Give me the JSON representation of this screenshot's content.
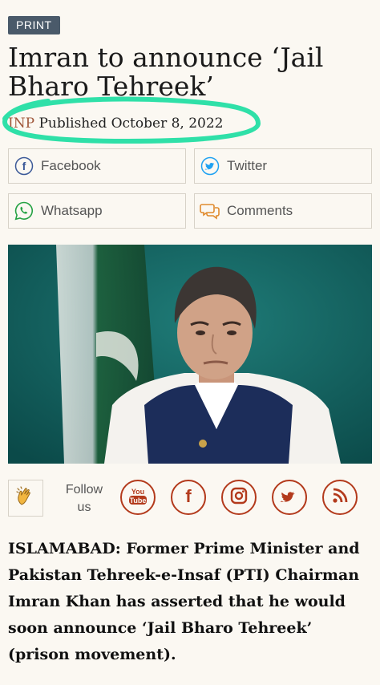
{
  "section_badge": "PRINT",
  "headline": "Imran to announce ‘Jail Bharo Tehreek’",
  "byline": {
    "source": "INP",
    "published": "Published October 8, 2022"
  },
  "share": {
    "facebook": "Facebook",
    "twitter": "Twitter",
    "whatsapp": "Whatsapp",
    "comments": "Comments"
  },
  "follow": {
    "line1": "Follow",
    "line2": "us"
  },
  "icons": {
    "facebook": "facebook-icon",
    "twitter": "twitter-icon",
    "whatsapp": "whatsapp-icon",
    "comments": "comments-icon",
    "clap": "clap-icon",
    "youtube": "youtube-icon",
    "instagram": "instagram-icon",
    "rss": "rss-icon"
  },
  "colors": {
    "badge": "#4a5a6a",
    "source": "#a0573a",
    "social": "#b33a1c",
    "highlight": "#2fe0a8",
    "background": "#fbf8f2"
  },
  "article_lead": "ISLAMABAD: Former Prime Minister and Pakistan Tehreek-e-Insaf (PTI) Chairman Imran Khan has asserted that he would soon announce ‘Jail Bharo Tehreek’ (prison movement)."
}
